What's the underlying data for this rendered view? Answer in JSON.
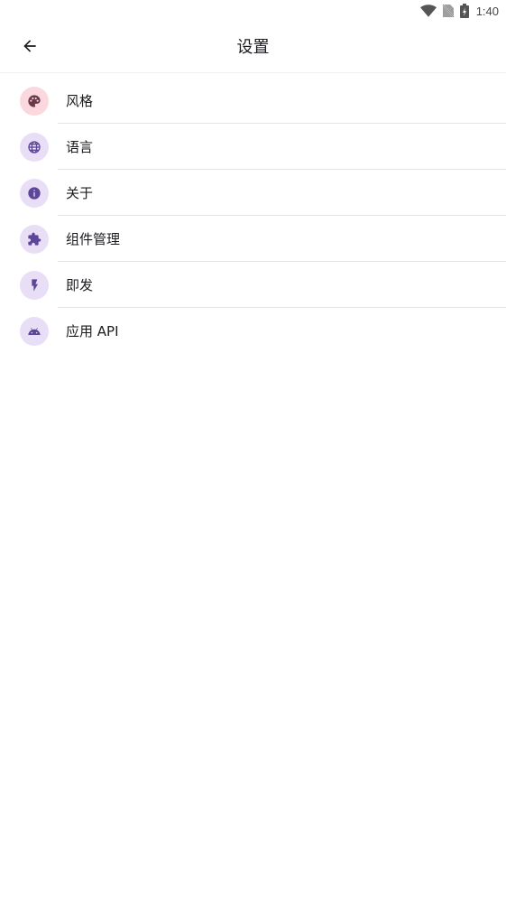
{
  "status_bar": {
    "time": "1:40",
    "icons": [
      "wifi-icon",
      "no-sim-icon",
      "battery-charging-icon"
    ]
  },
  "app_bar": {
    "title": "设置",
    "back_icon": "arrow-back-icon"
  },
  "settings": {
    "items": [
      {
        "label": "风格",
        "icon": "palette-icon",
        "icon_bg": "#fbd7de",
        "icon_color": "#6b3a4a"
      },
      {
        "label": "语言",
        "icon": "globe-icon",
        "icon_bg": "#e8dff7",
        "icon_color": "#5b4698"
      },
      {
        "label": "关于",
        "icon": "info-icon",
        "icon_bg": "#e8dff7",
        "icon_color": "#5b4698"
      },
      {
        "label": "组件管理",
        "icon": "puzzle-icon",
        "icon_bg": "#e8dff7",
        "icon_color": "#5b4698"
      },
      {
        "label": "即发",
        "icon": "bolt-icon",
        "icon_bg": "#e8dff7",
        "icon_color": "#5b4698"
      },
      {
        "label": "应用 API",
        "icon": "android-icon",
        "icon_bg": "#e8dff7",
        "icon_color": "#5b4698"
      }
    ]
  }
}
